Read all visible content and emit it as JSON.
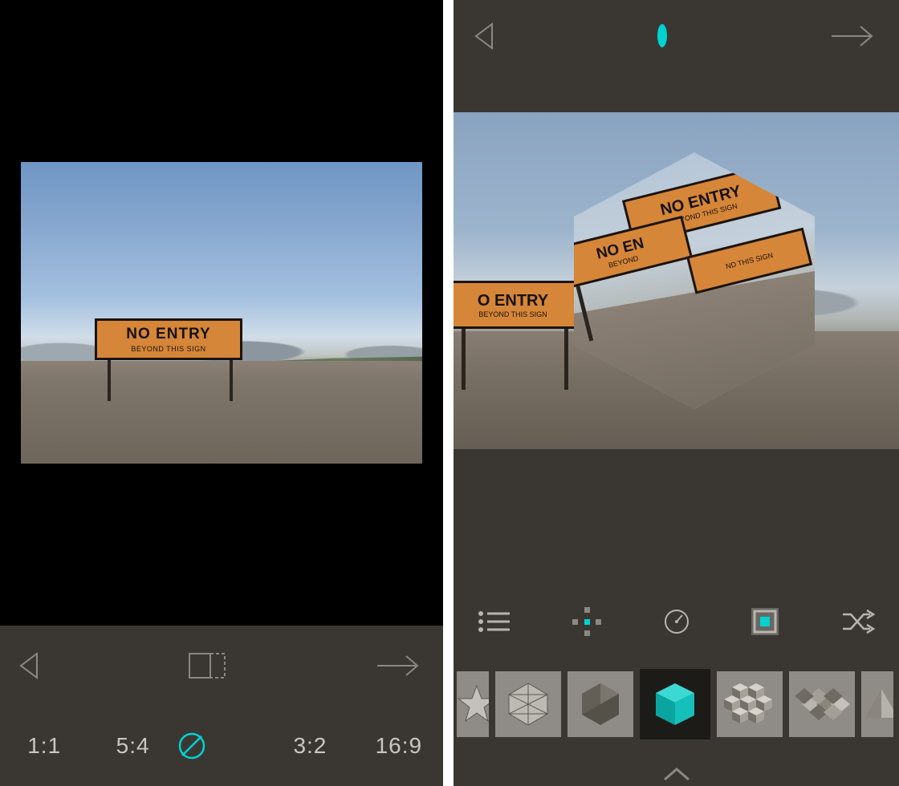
{
  "left": {
    "sign": {
      "line1": "NO ENTRY",
      "line2": "BEYOND THIS SIGN"
    },
    "ratios": [
      "1:1",
      "5:4",
      "",
      "3:2",
      "16:9"
    ]
  },
  "right": {
    "sign_bg": {
      "line1": "O ENTRY",
      "line2": "BEYOND THIS SIGN"
    },
    "sign_bg_partial": {
      "line1": "NO EN",
      "line2": "BEYOND"
    },
    "hex_sign1": {
      "line1": "NO ENTRY",
      "line2": "BEYOND THIS SIGN"
    },
    "hex_sign2": {
      "line1": "ND THIS SIGN"
    },
    "shapes": [
      "star",
      "icosahedron",
      "sphere",
      "cube",
      "cubes-pattern",
      "rhombus-pattern",
      "pyramid"
    ],
    "selected_shape_index": 3
  },
  "colors": {
    "accent": "#00d2d2"
  }
}
